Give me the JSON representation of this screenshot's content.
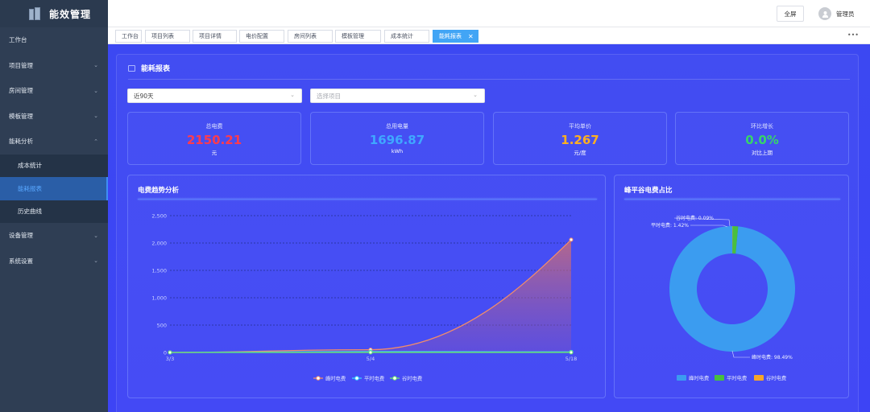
{
  "app": {
    "brand": "能效管理"
  },
  "sidebar": {
    "items": [
      {
        "label": "工作台",
        "chevron": ""
      },
      {
        "label": "项目管理",
        "chevron": "⌄"
      },
      {
        "label": "房间管理",
        "chevron": "⌄"
      },
      {
        "label": "模板管理",
        "chevron": "⌄"
      },
      {
        "label": "能耗分析",
        "chevron": "⌃"
      }
    ],
    "sub_items": [
      {
        "label": "成本统计"
      },
      {
        "label": "能耗报表"
      },
      {
        "label": "历史曲线"
      }
    ],
    "items_after": [
      {
        "label": "设备管理",
        "chevron": "⌄"
      },
      {
        "label": "系统设置",
        "chevron": "⌄"
      }
    ]
  },
  "header": {
    "fullscreen_label": "全屏",
    "username": "管理员"
  },
  "tabs": [
    "工作台",
    "项目列表",
    "项目详情",
    "电价配置",
    "房间列表",
    "模板管理",
    "成本统计",
    "能耗报表"
  ],
  "panel": {
    "title": "能耗报表"
  },
  "filters": {
    "range_value": "近90天",
    "project_placeholder": "选择项目"
  },
  "stats": [
    {
      "label": "总电费",
      "value": "2150.21",
      "unit": "元",
      "color": "#ff3b4e"
    },
    {
      "label": "总用电量",
      "value": "1696.87",
      "unit": "kWh",
      "color": "#3fa8ff"
    },
    {
      "label": "平均单价",
      "value": "1.267",
      "unit": "元/度",
      "color": "#ffb020"
    },
    {
      "label": "环比增长",
      "value": "0.0%",
      "unit": "对比上期",
      "color": "#36d46a"
    }
  ],
  "trend": {
    "title": "电费趋势分析"
  },
  "share": {
    "title": "峰平谷电费占比"
  },
  "chart_data": [
    {
      "type": "line",
      "title": "电费趋势分析",
      "x": [
        "3/3",
        "5/4",
        "5/18"
      ],
      "ylim": [
        0,
        2500
      ],
      "yticks": [
        "0",
        "500",
        "1,000",
        "1,500",
        "2,000",
        "2,500"
      ],
      "series": [
        {
          "name": "峰时电费",
          "values": [
            0,
            50,
            2060
          ],
          "color": "#f28c6a"
        },
        {
          "name": "平时电费",
          "values": [
            0,
            15,
            10
          ],
          "color": "#34d3ff"
        },
        {
          "name": "谷时电费",
          "values": [
            0,
            1,
            1
          ],
          "color": "#6be36b"
        }
      ],
      "grid": true,
      "legend": "bottom-center"
    },
    {
      "type": "pie",
      "title": "峰平谷电费占比",
      "labels": [
        "峰时电费",
        "平时电费",
        "谷时电费"
      ],
      "values": [
        98.49,
        1.42,
        0.09
      ],
      "slice_labels": [
        "峰时电费: 98.49%",
        "平时电费: 1.42%",
        "谷时电费: 0.09%"
      ],
      "colors": [
        "#3b9cf0",
        "#48c03e",
        "#f6a628"
      ],
      "legend": "bottom-center"
    }
  ]
}
